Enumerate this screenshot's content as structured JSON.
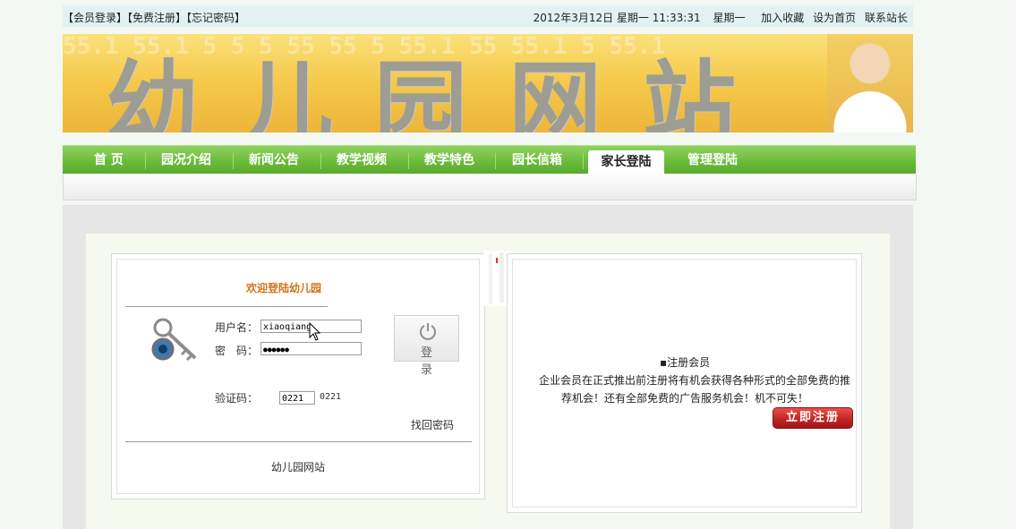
{
  "topbar": {
    "login_link": "【会员登录】",
    "register_link": "【免费注册】",
    "forgot_link": "【忘记密码】",
    "datetime": "2012年3月12日 星期一 11:33:31",
    "weekday": "星期一",
    "bookmark": "加入收藏",
    "homepage": "设为首页",
    "contact": "联系站长"
  },
  "banner": {
    "title": "幼儿园网站",
    "bg_text": "55.1 55.1 5 5 5 55 55 5 55.1 55 55.1 5 55.1"
  },
  "nav": {
    "items": [
      "首 页",
      "园况介绍",
      "新闻公告",
      "教学视频",
      "教学特色",
      "园长信箱",
      "家长登陆",
      "管理登陆"
    ],
    "active_index": 6
  },
  "login": {
    "welcome": "欢迎登陆幼儿园",
    "username_label": "用户名：",
    "username_value": "xiaoqiang",
    "password_label": "密　码：",
    "password_value": "●●●●●●",
    "login_button": "登录",
    "captcha_label": "验证码：",
    "captcha_value": "0221",
    "captcha_text": "0221",
    "find_password": "找回密码",
    "footer": "幼儿园网站"
  },
  "register": {
    "title": "▪注册会员",
    "desc_line1": "企业会员在正式推出前注册将有机会获得各种形式的全部免费的推",
    "desc_line2": "荐机会！还有全部免费的广告服务机会！机不可失！",
    "button": "立即注册"
  },
  "colors": {
    "nav_green": "#6bbb3a",
    "welcome_orange": "#d4731a",
    "register_red": "#c02622",
    "banner_yellow": "#f5c84a"
  }
}
